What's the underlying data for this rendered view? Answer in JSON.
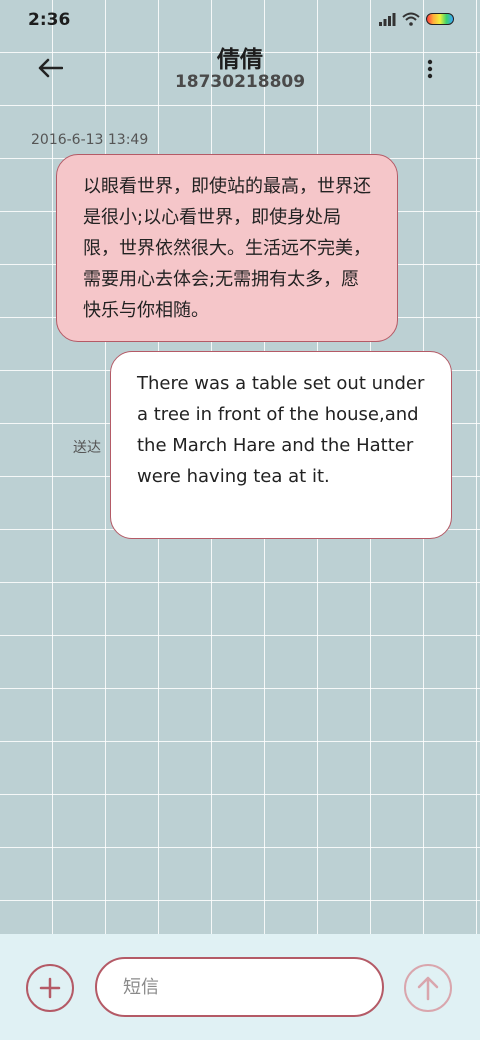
{
  "status_bar": {
    "time": "2:36",
    "icons": [
      "signal-icon",
      "wifi-icon",
      "battery-icon"
    ]
  },
  "header": {
    "contact_name": "倩倩",
    "contact_phone": "18730218809",
    "icons": {
      "back": "arrow-left-icon",
      "more": "more-vertical-icon"
    }
  },
  "messages": [
    {
      "type": "received",
      "timestamp": "2016-6-13 13:49",
      "text": "以眼看世界，即使站的最高，世界还是很小;以心看世界，即使身处局限，世界依然很大。生活远不完美，需要用心去体会;无需拥有太多，愿快乐与你相随。"
    },
    {
      "type": "sent",
      "status": "送达",
      "text": "There was a table set out under a tree in front of the house,and the March Hare and the Hatter were having tea at it."
    }
  ],
  "input_bar": {
    "placeholder": "短信",
    "value": "",
    "icons": {
      "add": "plus-icon",
      "send": "arrow-up-icon"
    }
  },
  "colors": {
    "accent": "#b45a66",
    "received_bubble": "#f5c6c9",
    "sent_bubble": "#ffffff",
    "background": "#bcd0d3",
    "input_bar": "#e0f1f4"
  }
}
